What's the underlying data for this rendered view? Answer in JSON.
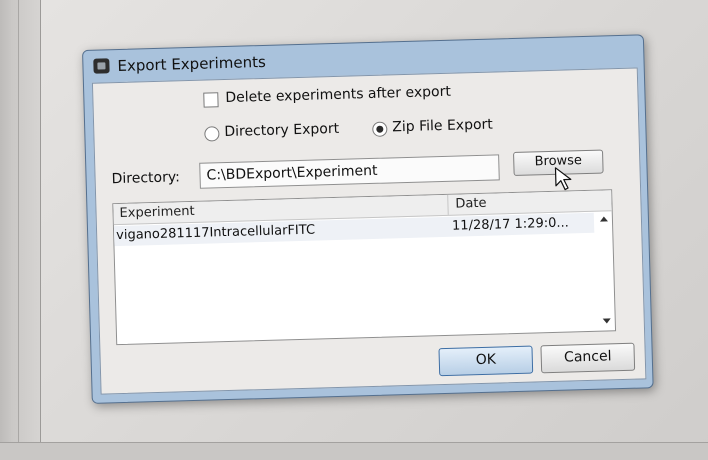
{
  "dialog": {
    "title": "Export Experiments",
    "icon": "app-window-icon"
  },
  "options": {
    "delete_after_export": {
      "label": "Delete experiments after export",
      "checked": false
    },
    "export_mode": {
      "options": [
        {
          "label": "Directory Export",
          "selected": false
        },
        {
          "label": "Zip File Export",
          "selected": true
        }
      ]
    }
  },
  "directory": {
    "label": "Directory:",
    "value": "C:\\BDExport\\Experiment",
    "browse_label": "Browse"
  },
  "table": {
    "columns": [
      "Experiment",
      "Date"
    ],
    "rows": [
      {
        "experiment": "vigano281117IntracellularFITC",
        "date": "11/28/17 1:29:0..."
      }
    ]
  },
  "buttons": {
    "ok": "OK",
    "cancel": "Cancel"
  },
  "colors": {
    "dialog_frame": "#a9c2dc",
    "ok_accent": "#3d6ea5"
  }
}
